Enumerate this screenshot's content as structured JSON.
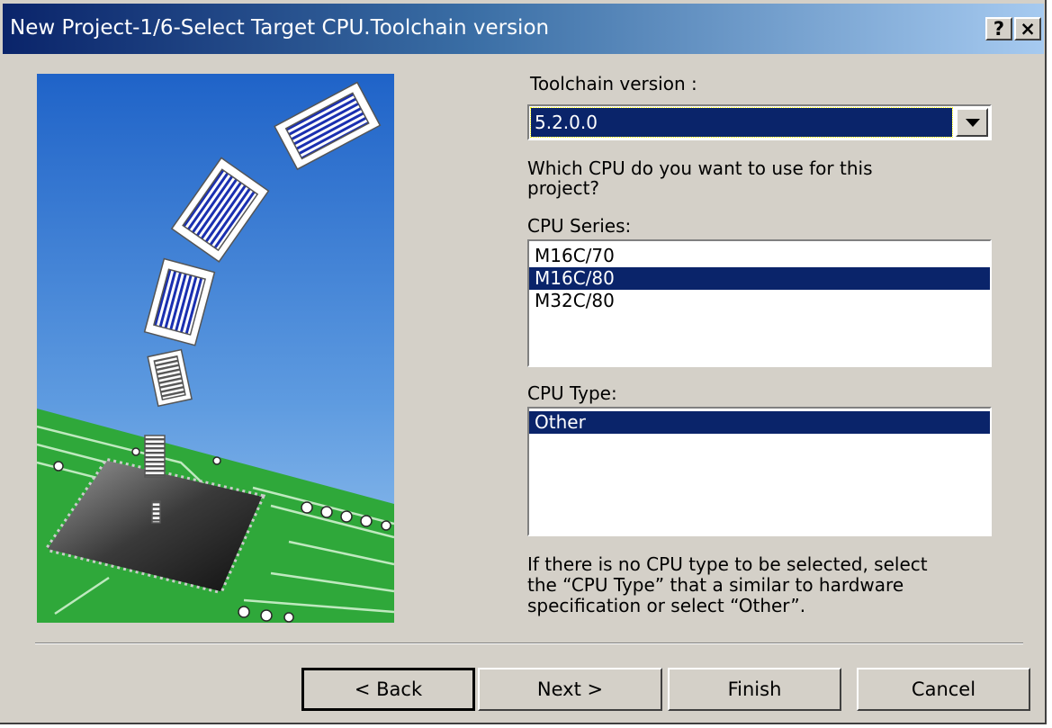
{
  "window": {
    "title": "New Project-1/6-Select Target CPU.Toolchain version",
    "help_button": "?",
    "close_button": "×"
  },
  "toolchain": {
    "label": "Toolchain version :",
    "selected": "5.2.0.0"
  },
  "question": {
    "line1": "Which CPU do you want to use for this",
    "line2": "project?"
  },
  "cpu_series": {
    "label": "CPU Series:",
    "items": [
      "M16C/70",
      "M16C/80",
      "M32C/80"
    ],
    "selected": "M16C/80"
  },
  "cpu_type": {
    "label": "CPU Type:",
    "items": [
      "Other"
    ],
    "selected": "Other"
  },
  "hint": {
    "line1": "If there is no CPU type to be selected, select",
    "line2": "the “CPU Type” that a similar to hardware",
    "line3": "specification or select “Other”."
  },
  "buttons": {
    "back": "< Back",
    "next": "Next >",
    "finish": "Finish",
    "cancel": "Cancel"
  },
  "colors": {
    "title_start": "#0a246a",
    "title_end": "#a6caf0",
    "selection": "#0a246a",
    "dialog_face": "#d4d0c8",
    "pcb_green": "#2fa83a"
  }
}
